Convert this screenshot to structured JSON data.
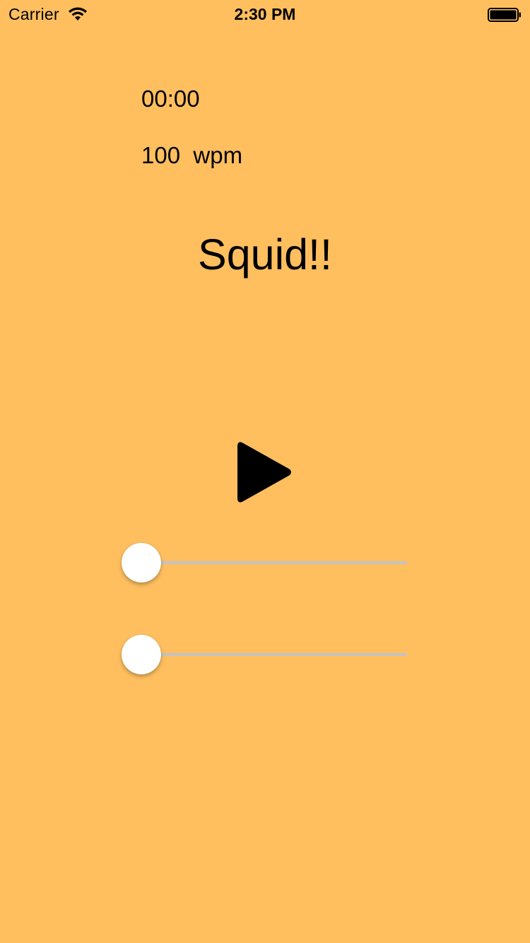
{
  "status_bar": {
    "carrier": "Carrier",
    "time": "2:30 PM",
    "wifi_icon": "wifi-icon",
    "battery_icon": "battery-full-icon"
  },
  "timer": "00:00",
  "wpm": {
    "value": "100",
    "unit": "wpm",
    "text": "100  wpm"
  },
  "current_word": "Squid!!",
  "play_icon": "play-icon",
  "sliders": [
    {
      "name": "slider-1",
      "value": 0
    },
    {
      "name": "slider-2",
      "value": 0
    }
  ],
  "colors": {
    "background": "#FFBF5F",
    "track": "#C3C3C3",
    "thumb": "#FFFFFF",
    "text": "#000000"
  }
}
